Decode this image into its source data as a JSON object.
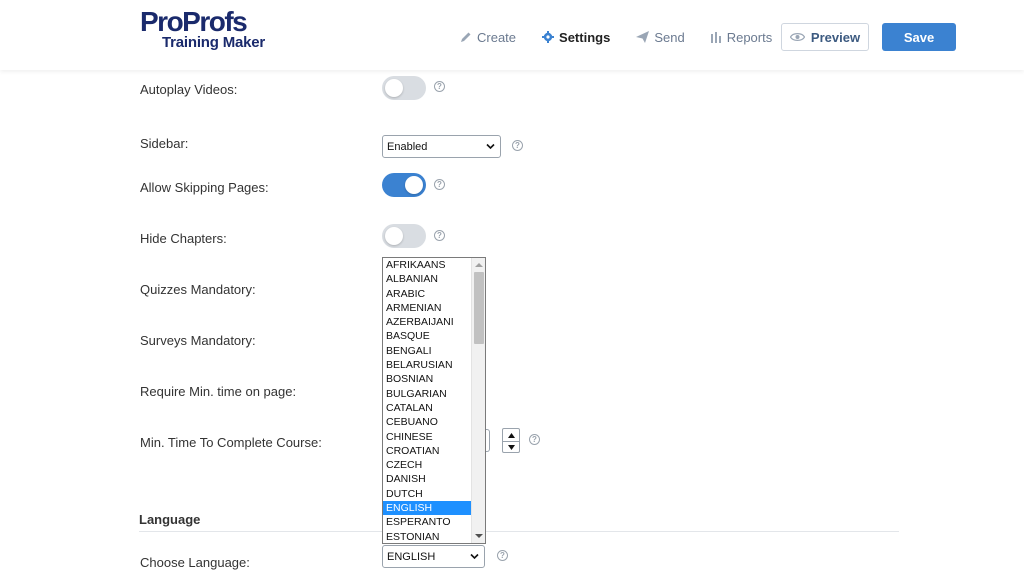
{
  "logo": {
    "brand": "ProProfs",
    "product": "Training Maker"
  },
  "nav": {
    "create": "Create",
    "settings": "Settings",
    "send": "Send",
    "reports": "Reports"
  },
  "buttons": {
    "preview": "Preview",
    "save": "Save"
  },
  "settings": {
    "autoplay_videos": {
      "label": "Autoplay Videos:",
      "on": false
    },
    "sidebar": {
      "label": "Sidebar:",
      "value": "Enabled"
    },
    "allow_skipping": {
      "label": "Allow Skipping Pages:",
      "on": true
    },
    "hide_chapters": {
      "label": "Hide Chapters:",
      "on": false
    },
    "quizzes_mandatory": {
      "label": "Quizzes Mandatory:"
    },
    "surveys_mandatory": {
      "label": "Surveys Mandatory:"
    },
    "require_min_time": {
      "label": "Require Min. time on page:"
    },
    "min_time_course": {
      "label": "Min. Time To Complete Course:"
    }
  },
  "language_section": {
    "title": "Language",
    "choose_label": "Choose Language:",
    "selected": "ENGLISH",
    "options": [
      "AFRIKAANS",
      "ALBANIAN",
      "ARABIC",
      "ARMENIAN",
      "AZERBAIJANI",
      "BASQUE",
      "BENGALI",
      "BELARUSIAN",
      "BOSNIAN",
      "BULGARIAN",
      "CATALAN",
      "CEBUANO",
      "CHINESE",
      "CROATIAN",
      "CZECH",
      "DANISH",
      "DUTCH",
      "ENGLISH",
      "ESPERANTO",
      "ESTONIAN"
    ]
  },
  "colors": {
    "accent": "#3b82d1",
    "toggle_off": "#d9dde2",
    "selected_option": "#1e90ff"
  }
}
